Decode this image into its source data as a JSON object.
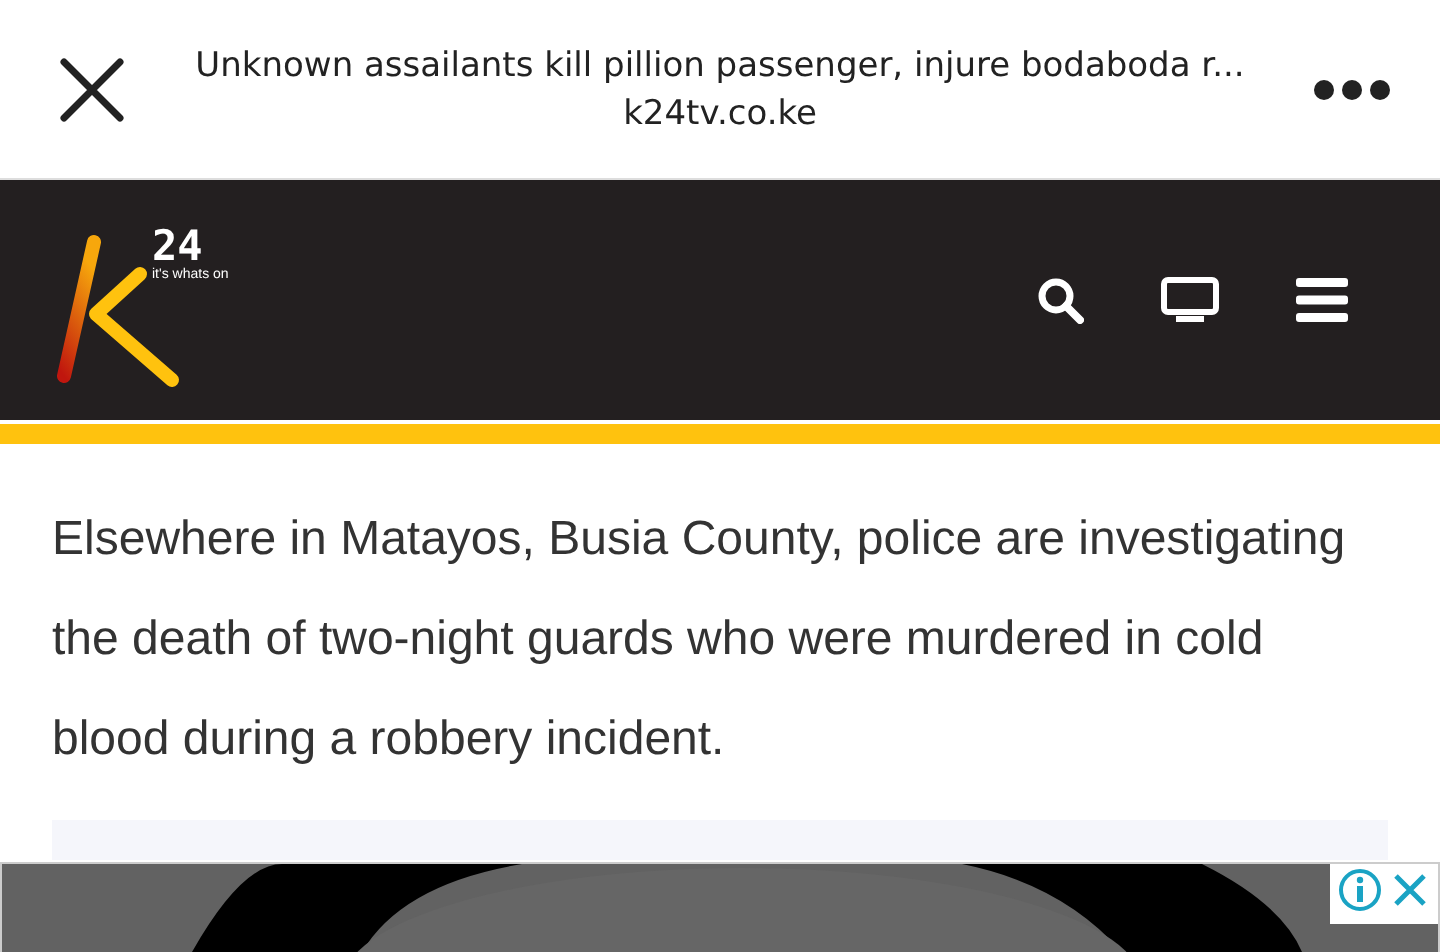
{
  "browser_bar": {
    "title": "Unknown assailants kill pillion passenger, injure bodaboda r...",
    "url": "k24tv.co.ke"
  },
  "site_header": {
    "logo": {
      "number": "24",
      "tagline": "it's whats on"
    }
  },
  "article": {
    "paragraph": "Elsewhere in Matayos, Busia County, police are investigating the death of two-night guards who were murdered in cold blood during a robbery incident."
  }
}
